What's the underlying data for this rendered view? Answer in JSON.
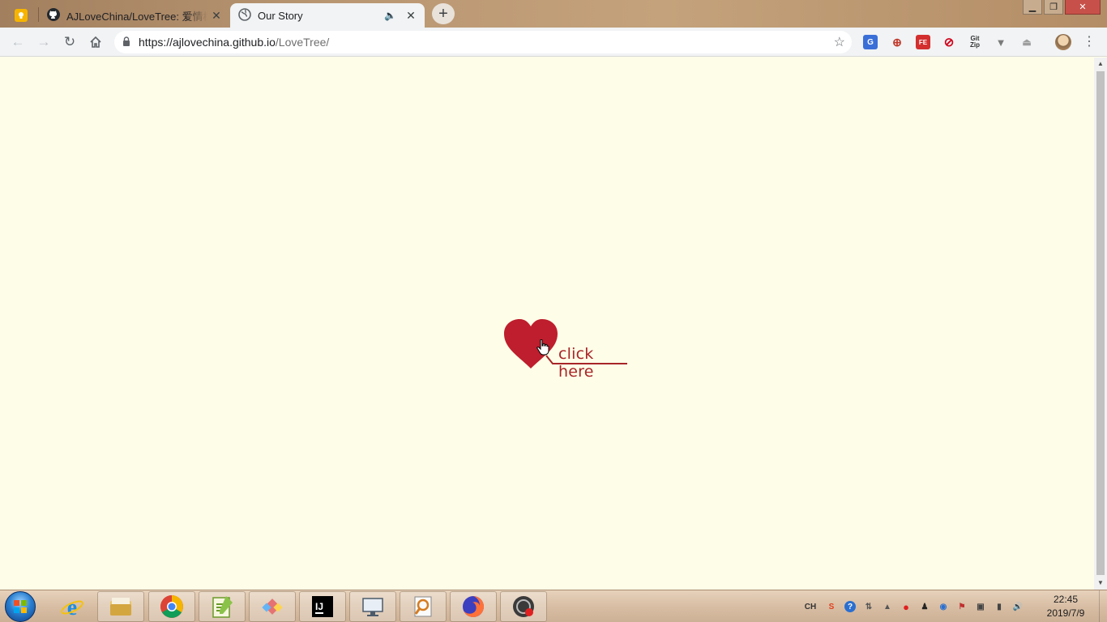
{
  "browser": {
    "tabs": [
      {
        "title": "AJLoveChina/LoveTree: 爱情树",
        "icon": "github-icon",
        "active": false
      },
      {
        "title": "Our Story",
        "icon": "globe-icon",
        "active": true,
        "audio_icon": "speaker-icon"
      }
    ],
    "pinned_tab_icon": "google-keep-icon",
    "new_tab_icon": "plus-icon",
    "window_controls": [
      "minimize-icon",
      "restore-icon",
      "close-icon"
    ],
    "address": {
      "host": "https://ajlovechina.github.io",
      "path": "/LoveTree/"
    },
    "extensions": [
      {
        "name": "google-translate-icon",
        "color": "#3a6fd8"
      },
      {
        "name": "extension-globe-icon",
        "color": "#c0392b"
      },
      {
        "name": "extension-fe-icon",
        "color": "#d32f2f"
      },
      {
        "name": "extension-circle-icon",
        "color": "#d0021b"
      },
      {
        "name": "gitzip-icon",
        "color": "#333333"
      },
      {
        "name": "extension-v-icon",
        "color": "#7a7a7a"
      },
      {
        "name": "extension-tree-icon",
        "color": "#9e9e9e"
      }
    ]
  },
  "page": {
    "background": "#fefee8",
    "link_text": "click here",
    "heart_color": "#be1e2d",
    "link_color": "#a82428"
  },
  "taskbar": {
    "apps": [
      {
        "name": "internet-explorer-icon",
        "running": false
      },
      {
        "name": "file-explorer-icon",
        "running": true
      },
      {
        "name": "chrome-icon",
        "running": true
      },
      {
        "name": "notepad-plus-plus-icon",
        "running": true
      },
      {
        "name": "git-extensions-icon",
        "running": true
      },
      {
        "name": "intellij-idea-icon",
        "running": true
      },
      {
        "name": "remote-desktop-icon",
        "running": true
      },
      {
        "name": "search-tool-icon",
        "running": true
      },
      {
        "name": "firefox-icon",
        "running": true
      },
      {
        "name": "screen-recorder-icon",
        "running": true
      }
    ],
    "tray": {
      "ime": "CH",
      "icons": [
        "sogou-icon",
        "help-icon",
        "network-share-icon",
        "show-hidden-icons-icon",
        "record-icon",
        "qq-icon",
        "network-icon",
        "flag-icon",
        "usb-icon",
        "signal-icon",
        "volume-icon"
      ]
    },
    "clock": {
      "time": "22:45",
      "date": "2019/7/9"
    }
  }
}
